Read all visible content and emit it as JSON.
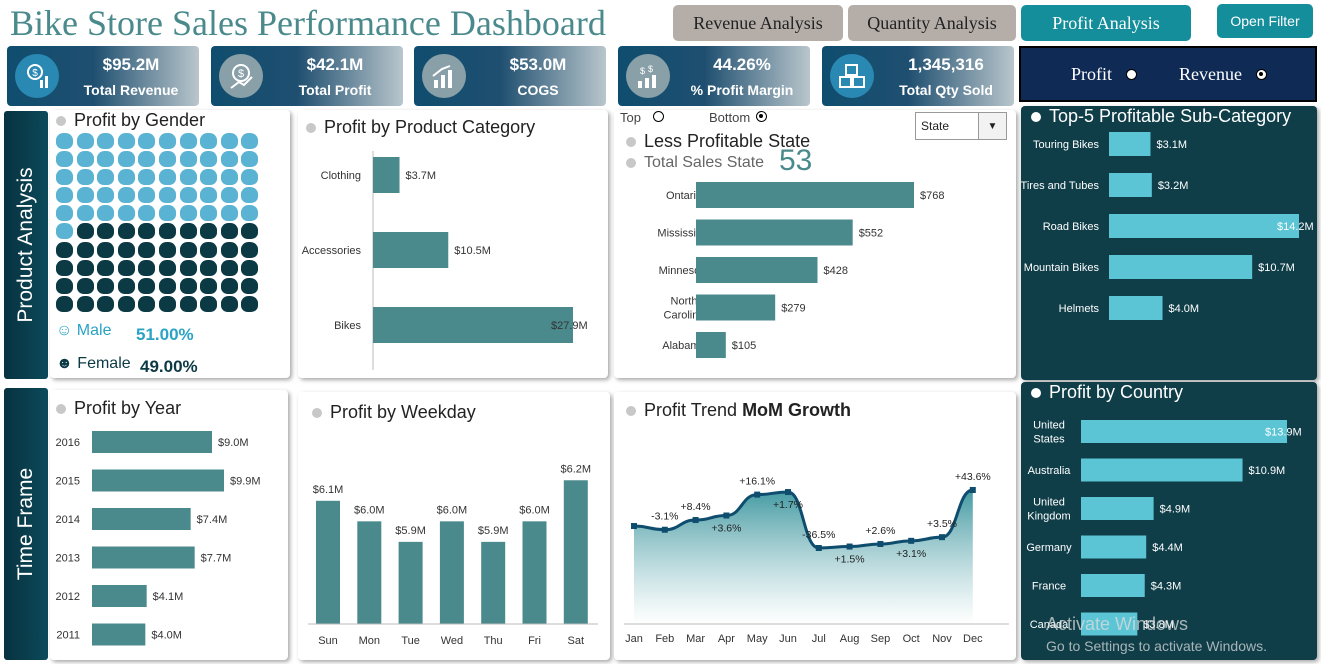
{
  "title": "Bike Store Sales Performance Dashboard",
  "nav": {
    "revenue": "Revenue Analysis",
    "quantity": "Quantity Analysis",
    "profit": "Profit Analysis",
    "filter": "Open Filter"
  },
  "kpis": [
    {
      "value": "$95.2M",
      "label": "Total Revenue",
      "icon": "revenue-icon"
    },
    {
      "value": "$42.1M",
      "label": "Total Profit",
      "icon": "profit-icon"
    },
    {
      "value": "$53.0M",
      "label": "COGS",
      "icon": "growth-chart-icon"
    },
    {
      "value": "44.26%",
      "label": "% Profit Margin",
      "icon": "money-growth-icon"
    },
    {
      "value": "1,345,316",
      "label": "Total Qty Sold",
      "icon": "boxes-icon"
    }
  ],
  "toggle": {
    "profit": "Profit",
    "revenue": "Revenue",
    "selected": "Revenue"
  },
  "sidebar": {
    "product": "Product Analysis",
    "time": "Time Frame"
  },
  "gender": {
    "title": "Profit by Gender",
    "male_label": "Male",
    "male_pct": "51.00%",
    "female_label": "Female",
    "female_pct": "49.00%",
    "male_color": "#5ab3d2",
    "female_color": "#0c3a44",
    "male_count": 51,
    "total": 100
  },
  "category": {
    "title": "Profit by Product Category"
  },
  "state": {
    "top_label": "Top",
    "bottom_label": "Bottom",
    "selected": "Bottom",
    "title": "Less Profitable State",
    "total_label": "Total Sales State",
    "total_value": "53",
    "dropdown": "State"
  },
  "subcat": {
    "title": "Top-5 Profitable Sub-Category"
  },
  "year": {
    "title": "Profit by Year"
  },
  "weekday": {
    "title": "Profit by Weekday"
  },
  "trend": {
    "title": "Profit Trend",
    "title_bold": "MoM Growth"
  },
  "country": {
    "title": "Profit by Country"
  },
  "watermark": {
    "line1": "Activate Windows",
    "line2": "Go to Settings to activate Windows."
  },
  "colors": {
    "bar": "#4a8a8c",
    "bar_light": "#5bc5d5",
    "dark_panel": "#0f3e49",
    "accent": "#158e9c"
  },
  "chart_data": [
    {
      "id": "category",
      "type": "bar",
      "orientation": "horizontal",
      "categories": [
        "Clothing",
        "Accessories",
        "Bikes"
      ],
      "values": [
        3.7,
        10.5,
        27.9
      ],
      "labels": [
        "$3.7M",
        "$10.5M",
        "$27.9M"
      ],
      "unit": "$M"
    },
    {
      "id": "state",
      "type": "bar",
      "orientation": "horizontal",
      "categories": [
        "Ontario",
        "Mississippi",
        "Minnesota",
        "North Carolina",
        "Alabama"
      ],
      "values": [
        768,
        552,
        428,
        279,
        105
      ],
      "labels": [
        "$768",
        "$552",
        "$428",
        "$279",
        "$105"
      ]
    },
    {
      "id": "subcat",
      "type": "bar",
      "orientation": "horizontal",
      "categories": [
        "Touring Bikes",
        "Tires and Tubes",
        "Road Bikes",
        "Mountain Bikes",
        "Helmets"
      ],
      "values": [
        3.1,
        3.2,
        14.2,
        10.7,
        4.0
      ],
      "labels": [
        "$3.1M",
        "$3.2M",
        "$14.2M",
        "$10.7M",
        "$4.0M"
      ],
      "unit": "$M"
    },
    {
      "id": "year",
      "type": "bar",
      "orientation": "horizontal",
      "categories": [
        "2016",
        "2015",
        "2014",
        "2013",
        "2012",
        "2011"
      ],
      "values": [
        9.0,
        9.9,
        7.4,
        7.7,
        4.1,
        4.0
      ],
      "labels": [
        "$9.0M",
        "$9.9M",
        "$7.4M",
        "$7.7M",
        "$4.1M",
        "$4.0M"
      ],
      "unit": "$M"
    },
    {
      "id": "weekday",
      "type": "bar",
      "orientation": "vertical",
      "categories": [
        "Sun",
        "Mon",
        "Tue",
        "Wed",
        "Thu",
        "Fri",
        "Sat"
      ],
      "values": [
        6.1,
        6.0,
        5.9,
        6.0,
        5.9,
        6.0,
        6.2
      ],
      "labels": [
        "$6.1M",
        "$6.0M",
        "$5.9M",
        "$6.0M",
        "$5.9M",
        "$6.0M",
        "$6.2M"
      ],
      "unit": "$M"
    },
    {
      "id": "trend",
      "type": "area",
      "categories": [
        "Jan",
        "Feb",
        "Mar",
        "Apr",
        "May",
        "Jun",
        "Jul",
        "Aug",
        "Sep",
        "Oct",
        "Nov",
        "Dec"
      ],
      "labels": [
        "",
        "-3.1%",
        "+8.4%",
        "+3.6%",
        "+16.1%",
        "+1.7%",
        "-36.5%",
        "+1.5%",
        "+2.6%",
        "+3.1%",
        "+3.5%",
        "+43.6%"
      ],
      "growth_pct": [
        null,
        -3.1,
        8.4,
        3.6,
        16.1,
        1.7,
        -36.5,
        1.5,
        2.6,
        3.1,
        3.5,
        43.6
      ]
    },
    {
      "id": "country",
      "type": "bar",
      "orientation": "horizontal",
      "categories": [
        "United States",
        "Australia",
        "United Kingdom",
        "Germany",
        "France",
        "Canada"
      ],
      "values": [
        13.9,
        10.9,
        4.9,
        4.4,
        4.3,
        3.8
      ],
      "labels": [
        "$13.9M",
        "$10.9M",
        "$4.9M",
        "$4.4M",
        "$4.3M",
        "$3.8M"
      ],
      "unit": "$M"
    }
  ]
}
